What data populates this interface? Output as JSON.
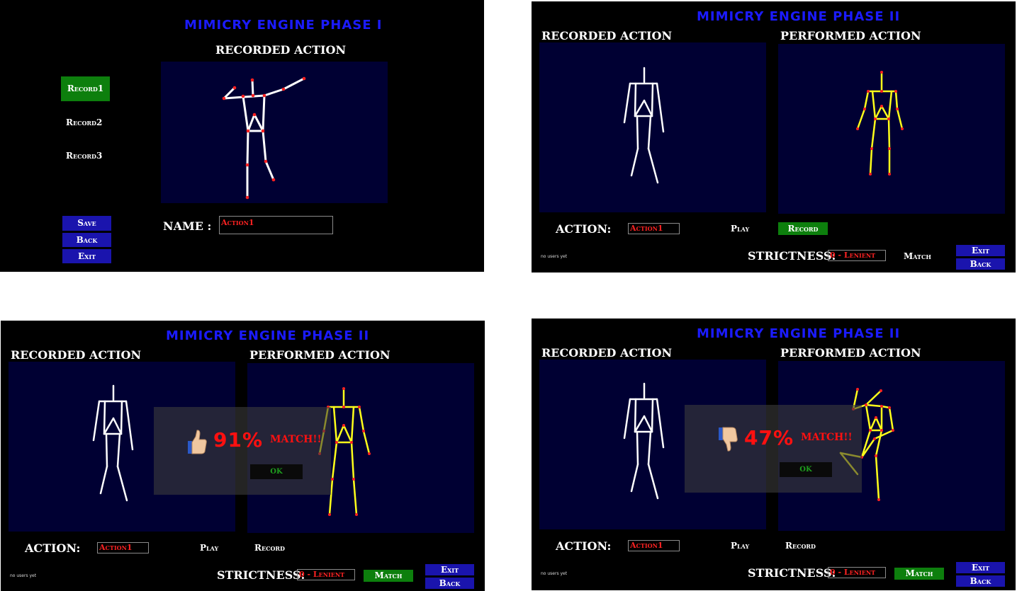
{
  "phase1": {
    "title": "MIMICRY ENGINE PHASE I",
    "heading": "RECORDED ACTION",
    "records": [
      "Record1",
      "Record2",
      "Record3"
    ],
    "save_label": "Save",
    "back_label": "Back",
    "exit_label": "Exit",
    "name_label": "NAME :",
    "name_value": "Action1"
  },
  "phase2": {
    "title": "MIMICRY ENGINE PHASE II",
    "recorded_heading": "RECORDED ACTION",
    "performed_heading": "PERFORMED ACTION",
    "action_label": "ACTION:",
    "action_value": "Action1",
    "play_label": "Play",
    "record_label": "Record",
    "strictness_label": "STRICTNESS:",
    "strictness_value": "0 - Lenient",
    "match_label": "Match",
    "exit_label": "Exit",
    "back_label": "Back",
    "users_status": "no users yet"
  },
  "results": {
    "match_high": "91%",
    "match_low": "47%",
    "match_text": "MATCH!!",
    "ok_label": "OK"
  },
  "colors": {
    "title_blue": "#1b1bff",
    "button_blue": "#1a14ad",
    "button_green": "#0d7f0d",
    "canvas_navy": "#000033",
    "skeleton_yellow": "#ffff1a",
    "joint_red": "#ff2020",
    "match_red": "#ff1010"
  },
  "icons": {
    "thumbs_up": "thumbs-up-icon",
    "thumbs_down": "thumbs-down-icon"
  }
}
